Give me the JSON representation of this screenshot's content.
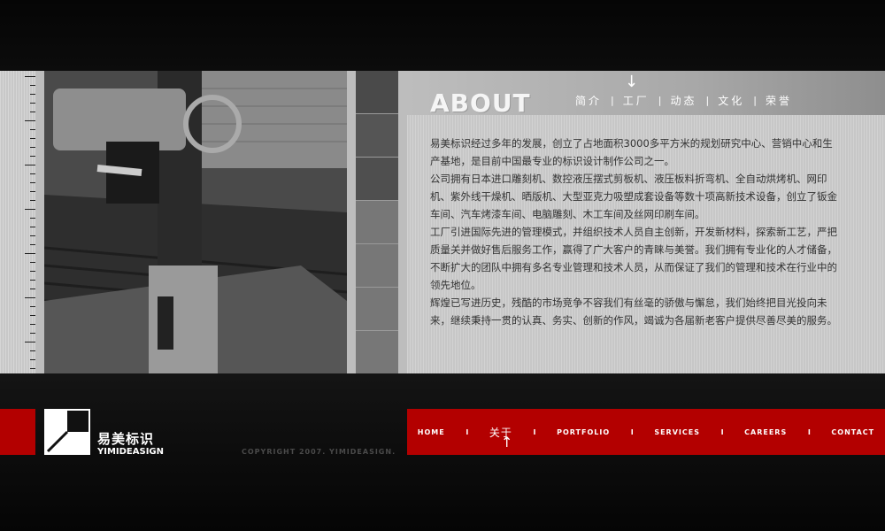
{
  "about": {
    "title": "ABOUT"
  },
  "subnav": {
    "items": [
      "简介",
      "工厂",
      "动态",
      "文化",
      "荣誉"
    ],
    "separator": "|",
    "active_arrow": "↓"
  },
  "content": {
    "paragraphs": [
      "易美标识经过多年的发展，创立了占地面积3000多平方米的规划研究中心、营销中心和生产基地，是目前中国最专业的标识设计制作公司之一。",
      "公司拥有日本进口雕刻机、数控液压摆式剪板机、液压板料折弯机、全自动烘烤机、网印机、紫外线干燥机、晒版机、大型亚克力吸塑成套设备等数十项高新技术设备，创立了钣金车间、汽车烤漆车间、电脑雕刻、木工车间及丝网印刷车间。",
      "工厂引进国际先进的管理模式，并组织技术人员自主创新，开发新材料，探索新工艺，严把质量关并做好售后服务工作，赢得了广大客户的青睐与美誉。我们拥有专业化的人才储备，不断扩大的团队中拥有多名专业管理和技术人员，从而保证了我们的管理和技术在行业中的领先地位。",
      "辉煌已写进历史，残酷的市场竞争不容我们有丝毫的骄傲与懈怠，我们始终把目光投向未来，继续秉持一贯的认真、务实、创新的作风，竭诚为各届新老客户提供尽善尽美的服务。"
    ]
  },
  "logo": {
    "name_cn": "易美标识",
    "name_en": "YIMIDEASIGN"
  },
  "copyright": "COPYRIGHT 2007. YIMIDEASIGN.",
  "mainnav": {
    "items": [
      "HOME",
      "关于",
      "PORTFOLIO",
      "SERVICES",
      "CAREERS",
      "CONTACT"
    ],
    "separator": "I",
    "active_arrow": "↑"
  },
  "colors": {
    "accent_red": "#b30000",
    "background": "#111111"
  }
}
